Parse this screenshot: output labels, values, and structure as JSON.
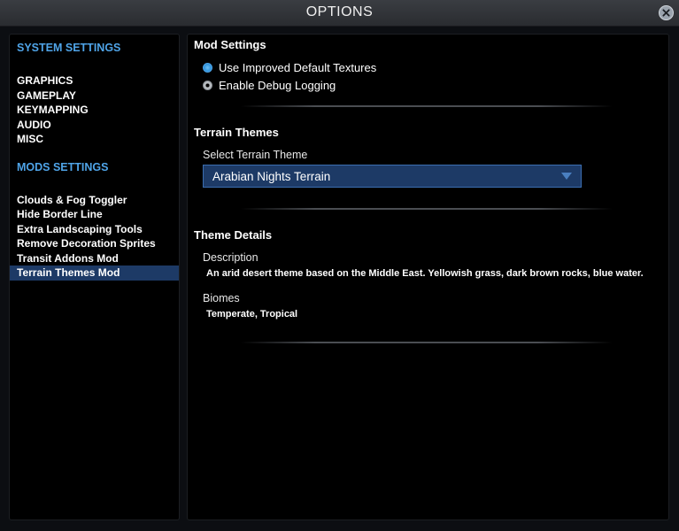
{
  "window": {
    "title": "OPTIONS"
  },
  "sidebar": {
    "system_title": "SYSTEM SETTINGS",
    "system_items": [
      "GRAPHICS",
      "GAMEPLAY",
      "KEYMAPPING",
      "AUDIO",
      "MISC"
    ],
    "mods_title": "MODS SETTINGS",
    "mods_items": [
      "Clouds & Fog Toggler",
      "Hide Border Line",
      "Extra Landscaping Tools",
      "Remove Decoration Sprites",
      "Transit Addons Mod",
      "Terrain Themes Mod"
    ],
    "selected": "Terrain Themes Mod"
  },
  "mod_settings": {
    "title": "Mod Settings",
    "options": [
      {
        "label": "Use Improved Default Textures",
        "checked": true
      },
      {
        "label": "Enable Debug Logging",
        "checked": false
      }
    ]
  },
  "terrain_themes": {
    "title": "Terrain Themes",
    "select_label": "Select Terrain Theme",
    "selected_value": "Arabian Nights Terrain"
  },
  "theme_details": {
    "title": "Theme Details",
    "description_label": "Description",
    "description": "An arid desert theme based on the Middle East. Yellowish grass, dark brown rocks, blue water.",
    "biomes_label": "Biomes",
    "biomes": "Temperate, Tropical"
  },
  "colors": {
    "accent": "#4fa4e8",
    "selection": "#1d3a66",
    "background": "#000000"
  }
}
